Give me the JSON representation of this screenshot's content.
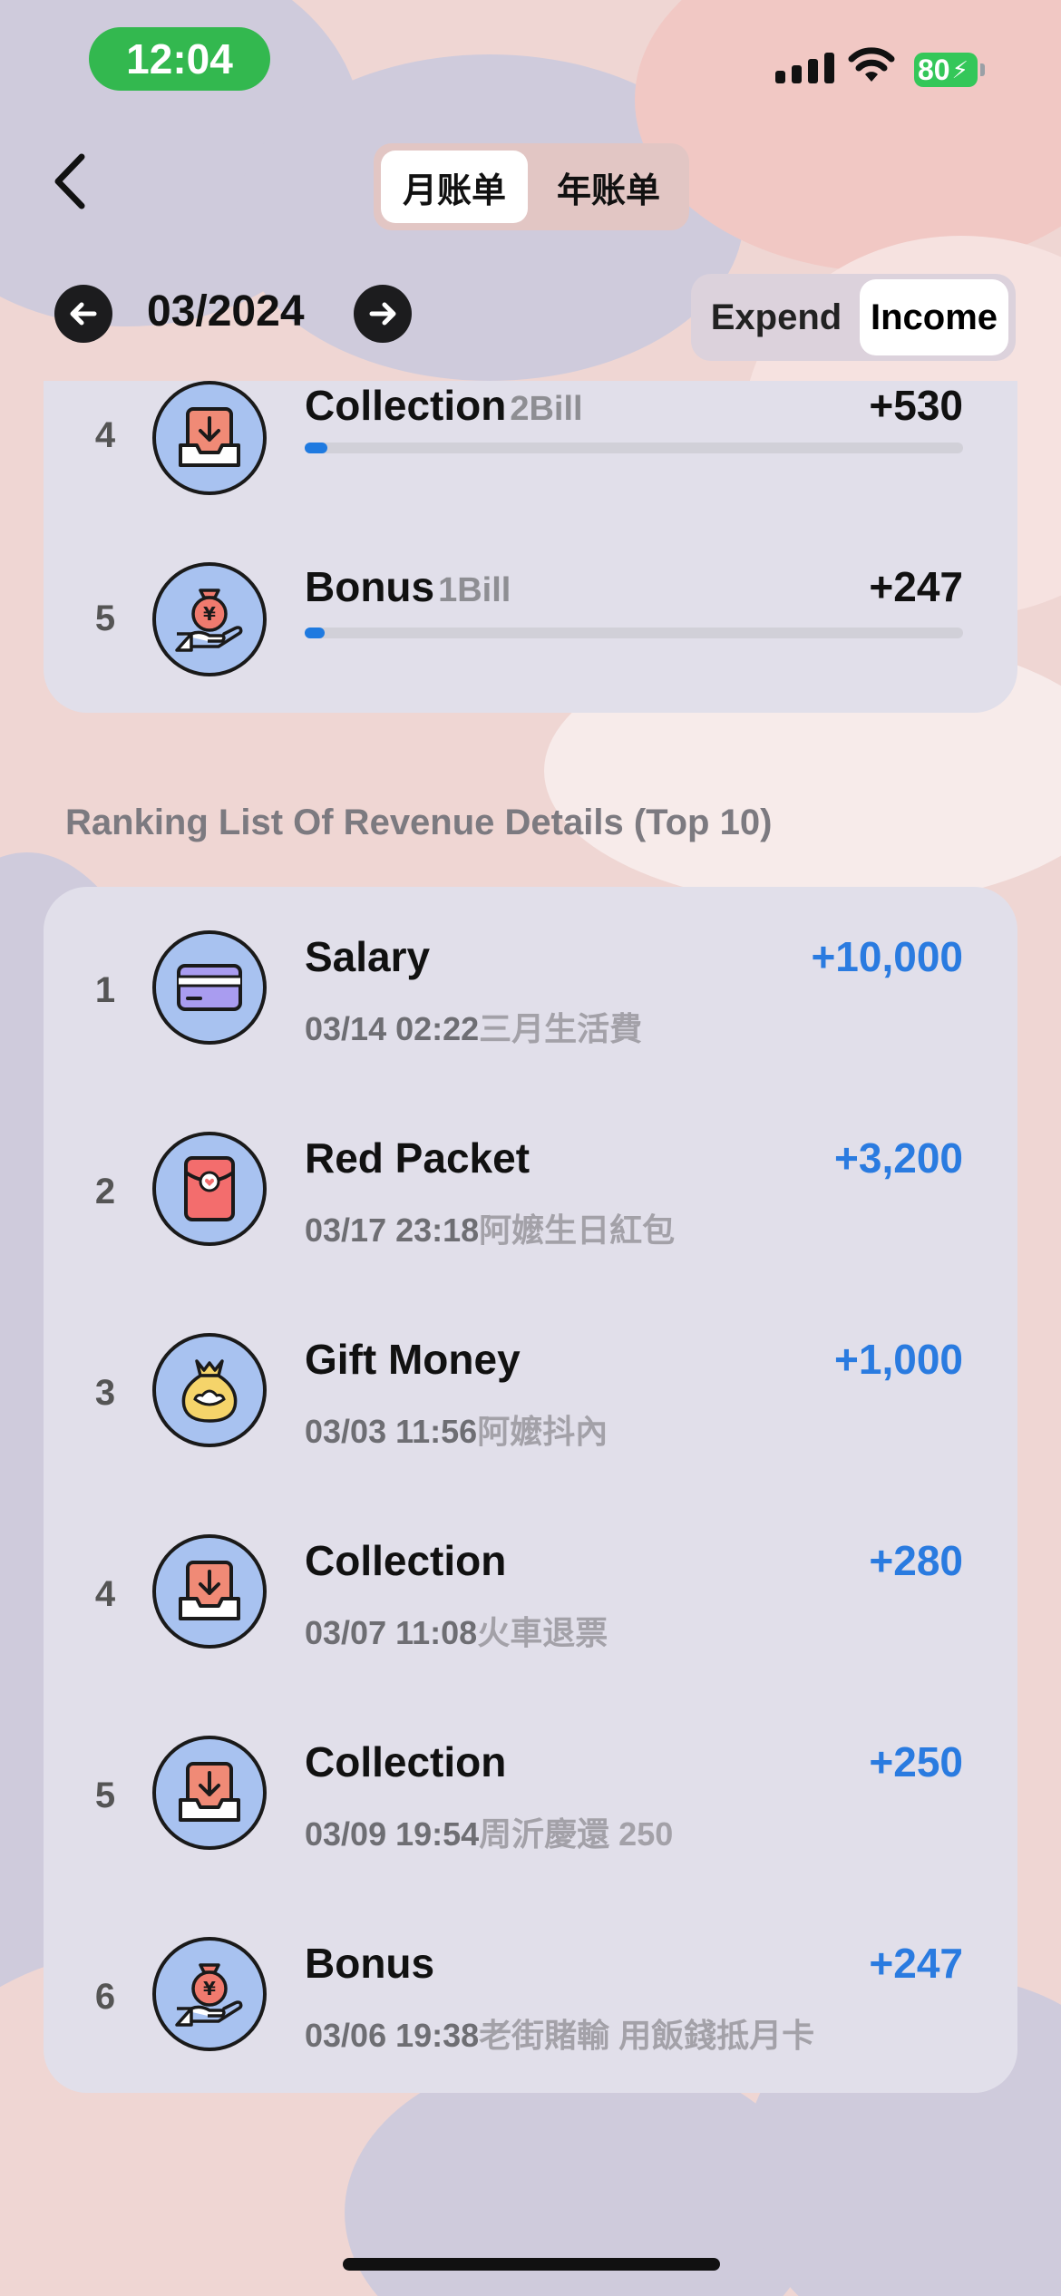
{
  "status": {
    "time": "12:04",
    "battery": "80"
  },
  "header": {
    "tab_month": "月账单",
    "tab_year": "年账单"
  },
  "period": {
    "label": "03/2024"
  },
  "type_toggle": {
    "expend": "Expend",
    "income": "Income"
  },
  "colors": {
    "accent": "#2a7be0",
    "bar": "#1f7ae0",
    "card": "#e1dfea"
  },
  "categories": [
    {
      "rank": "4",
      "name": "Collection",
      "count": "2Bill",
      "amount": "+530",
      "share": 0.035,
      "icon": "inbox-download-icon"
    },
    {
      "rank": "5",
      "name": "Bonus",
      "count": "1Bill",
      "amount": "+247",
      "share": 0.03,
      "icon": "money-bag-hand-icon"
    }
  ],
  "details": {
    "title": "Ranking List Of Revenue Details (Top 10)",
    "items": [
      {
        "rank": "1",
        "title": "Salary",
        "datetime": "03/14 02:22",
        "note": "三月生活費",
        "amount": "+10,000",
        "icon": "credit-card-icon"
      },
      {
        "rank": "2",
        "title": "Red Packet",
        "datetime": "03/17 23:18",
        "note": "阿嬤生日紅包",
        "amount": "+3,200",
        "icon": "red-envelope-icon"
      },
      {
        "rank": "3",
        "title": "Gift Money",
        "datetime": "03/03 11:56",
        "note": "阿嬤抖內",
        "amount": "+1,000",
        "icon": "gift-money-bag-icon"
      },
      {
        "rank": "4",
        "title": "Collection",
        "datetime": "03/07 11:08",
        "note": "火車退票",
        "amount": "+280",
        "icon": "inbox-download-icon"
      },
      {
        "rank": "5",
        "title": "Collection",
        "datetime": "03/09 19:54",
        "note": "周沂慶還 250",
        "amount": "+250",
        "icon": "inbox-download-icon"
      },
      {
        "rank": "6",
        "title": "Bonus",
        "datetime": "03/06 19:38",
        "note": "老街賭輸 用飯錢抵月卡",
        "amount": "+247",
        "icon": "money-bag-hand-icon"
      }
    ]
  }
}
